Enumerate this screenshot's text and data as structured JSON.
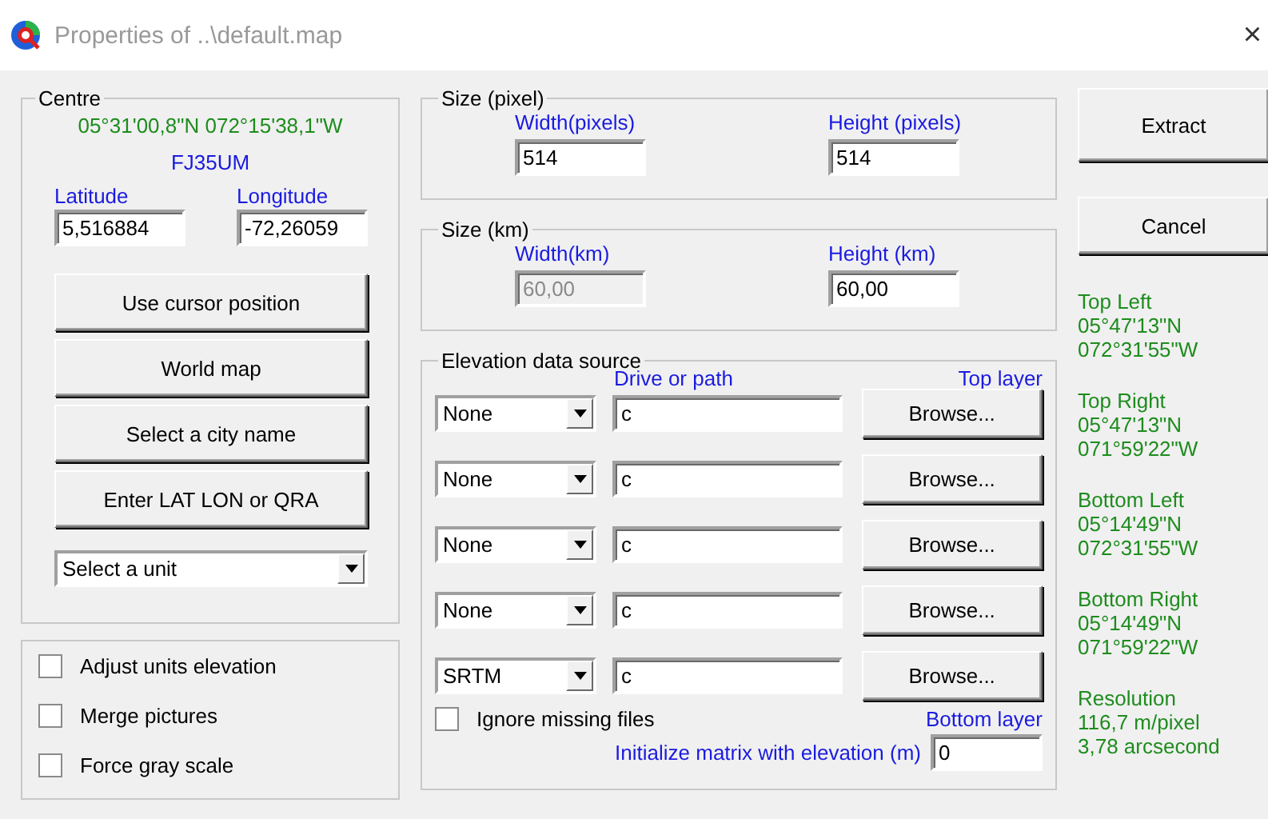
{
  "window": {
    "title": "Properties of ..\\default.map",
    "close": "×"
  },
  "centre": {
    "legend": "Centre",
    "coordinates": "05°31'00,8\"N 072°15'38,1\"W",
    "locator": "FJ35UM",
    "latitude": {
      "label": "Latitude",
      "value": "5,516884"
    },
    "longitude": {
      "label": "Longitude",
      "value": "-72,26059"
    },
    "buttons": [
      "Use cursor position",
      "World map",
      "Select a city name",
      "Enter LAT LON or QRA"
    ],
    "unit_select": {
      "value": "Select a unit"
    }
  },
  "options": [
    {
      "label": "Adjust units elevation",
      "checked": false
    },
    {
      "label": "Merge pictures",
      "checked": false
    },
    {
      "label": "Force gray scale",
      "checked": false
    }
  ],
  "size_pixel": {
    "legend": "Size (pixel)",
    "width": {
      "label": "Width(pixels)",
      "value": "514",
      "disabled": false
    },
    "height": {
      "label": "Height (pixels)",
      "value": "514",
      "disabled": false
    }
  },
  "size_km": {
    "legend": "Size (km)",
    "width": {
      "label": "Width(km)",
      "value": "60,00",
      "disabled": true
    },
    "height": {
      "label": "Height (km)",
      "value": "60,00",
      "disabled": false
    }
  },
  "elevation": {
    "legend": "Elevation data source",
    "path_header": "Drive or path",
    "top_label": "Top layer",
    "rows": [
      {
        "source": "None",
        "path": "c",
        "button": "Browse..."
      },
      {
        "source": "None",
        "path": "c",
        "button": "Browse..."
      },
      {
        "source": "None",
        "path": "c",
        "button": "Browse..."
      },
      {
        "source": "None",
        "path": "c",
        "button": "Browse..."
      },
      {
        "source": "SRTM",
        "path": "c",
        "button": "Browse..."
      }
    ],
    "ignore_missing": {
      "label": "Ignore missing files",
      "checked": false
    },
    "bottom_label": "Bottom layer",
    "init": {
      "label": "Initialize matrix with elevation (m)",
      "value": "0"
    }
  },
  "actions": [
    "Extract",
    "Cancel"
  ],
  "corners": [
    {
      "title": "Top Left",
      "lat": "05°47'13\"N",
      "lon": "072°31'55\"W"
    },
    {
      "title": "Top Right",
      "lat": "05°47'13\"N",
      "lon": "071°59'22\"W"
    },
    {
      "title": "Bottom Left",
      "lat": "05°14'49\"N",
      "lon": "072°31'55\"W"
    },
    {
      "title": "Bottom Right",
      "lat": "05°14'49\"N",
      "lon": "071°59'22\"W"
    }
  ],
  "resolution": {
    "title": "Resolution",
    "lines": [
      "116,7 m/pixel",
      "3,78 arcsecond"
    ]
  }
}
